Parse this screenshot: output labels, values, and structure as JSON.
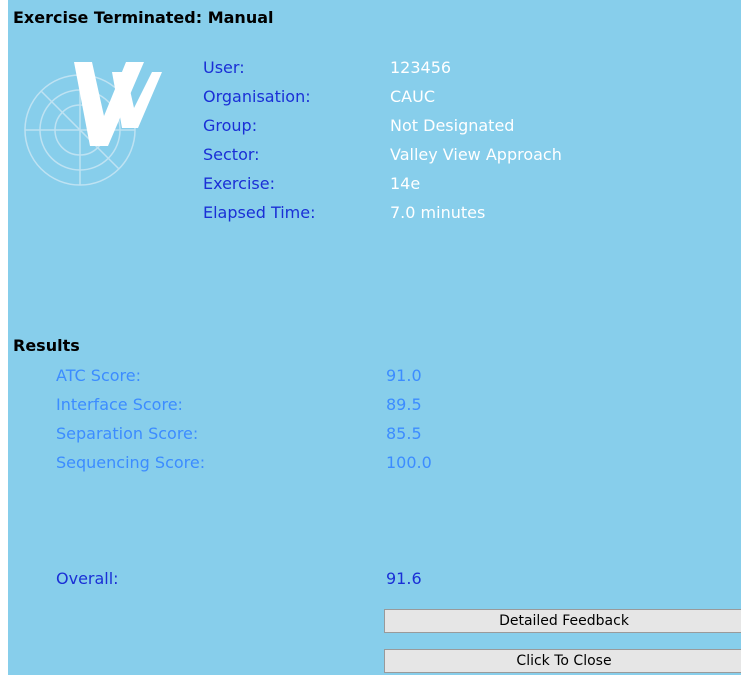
{
  "title": "Exercise Terminated: Manual",
  "info": [
    {
      "label": "User:",
      "value": "123456"
    },
    {
      "label": "Organisation:",
      "value": "CAUC"
    },
    {
      "label": "Group:",
      "value": "Not Designated"
    },
    {
      "label": "Sector:",
      "value": "Valley View Approach"
    },
    {
      "label": "Exercise:",
      "value": "14e"
    },
    {
      "label": "Elapsed Time:",
      "value": "7.0 minutes"
    }
  ],
  "results": {
    "heading": "Results",
    "scores": [
      {
        "label": "ATC Score:",
        "value": "91.0"
      },
      {
        "label": "Interface Score:",
        "value": "89.5"
      },
      {
        "label": "Separation Score:",
        "value": "85.5"
      },
      {
        "label": "Sequencing Score:",
        "value": "100.0"
      }
    ],
    "overall_label": "Overall:",
    "overall_value": "91.6"
  },
  "buttons": {
    "feedback": "Detailed Feedback",
    "close": "Click To Close"
  },
  "colors": {
    "panel_bg": "#87ceeb",
    "label_blue": "#1a2fd6",
    "score_blue": "#3c8cff",
    "value_white": "#ffffff"
  },
  "icons": {
    "logo": "radar-vv-logo-icon"
  }
}
